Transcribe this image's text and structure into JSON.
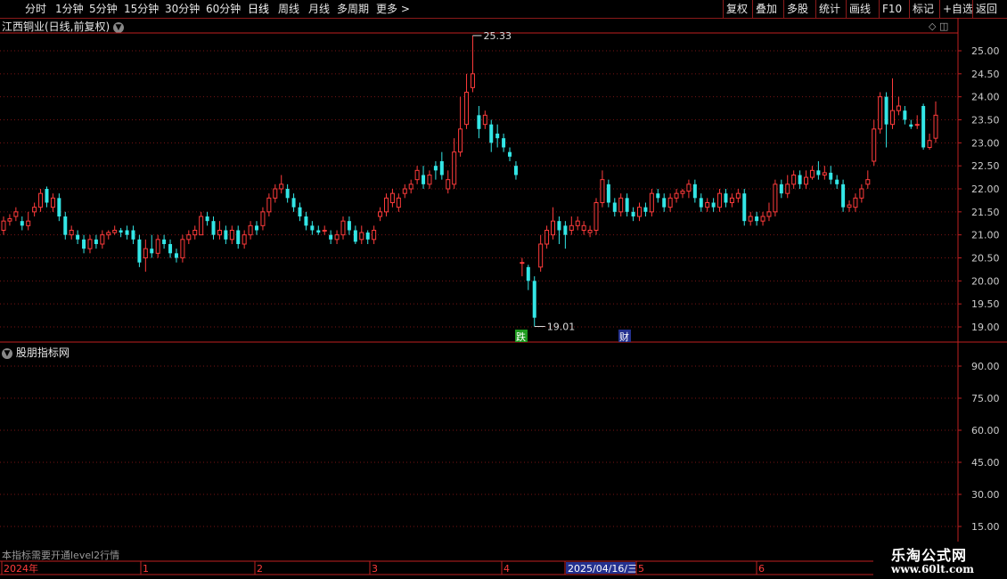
{
  "toolbar": {
    "periods": [
      "分时",
      "1分钟",
      "5分钟",
      "15分钟",
      "30分钟",
      "60分钟",
      "日线",
      "周线",
      "月线",
      "多周期",
      "更多 >"
    ],
    "active_period": "日线",
    "actions": [
      "复权",
      "叠加",
      "多股",
      "统计",
      "画线",
      "F10",
      "标记",
      "+自选",
      "返回"
    ]
  },
  "main_panel": {
    "title": "江西铜业(日线,前复权)"
  },
  "sub_panel": {
    "title": "股朋指标网",
    "note": "本指标需要开通level2行情"
  },
  "brand": {
    "name": "乐淘公式网",
    "url": "www.60lt.com"
  },
  "colors": {
    "up": "#ff3b3b",
    "down": "#33e6e6",
    "grid": "#7a1414",
    "axis": "#c02020",
    "text": "#cccccc",
    "badge_green": "#1e9a1e",
    "badge_blue": "#24318f"
  },
  "chart_data": [
    {
      "type": "candlestick",
      "title": "江西铜业(日线,前复权)",
      "ylim": [
        18.8,
        25.6
      ],
      "y_ticks": [
        "25.00",
        "24.50",
        "24.00",
        "23.50",
        "23.00",
        "22.50",
        "22.00",
        "21.50",
        "21.00",
        "20.50",
        "20.00",
        "19.50",
        "19.00"
      ],
      "annotations": {
        "high_label": "25.33",
        "low_label": "19.01"
      },
      "badges": [
        {
          "text": "跌",
          "color": "green"
        },
        {
          "text": "财",
          "color": "blue"
        }
      ],
      "x_labels": [
        "2024年",
        "1",
        "2",
        "3",
        "4",
        "2025/04/16/三",
        "5",
        "6"
      ],
      "candles": [
        [
          21.1,
          21.3,
          21.4,
          21.0
        ],
        [
          21.3,
          21.35,
          21.45,
          21.2
        ],
        [
          21.4,
          21.5,
          21.6,
          21.3
        ],
        [
          21.3,
          21.2,
          21.4,
          21.1
        ],
        [
          21.2,
          21.3,
          21.5,
          21.1
        ],
        [
          21.5,
          21.6,
          21.7,
          21.4
        ],
        [
          21.6,
          21.9,
          22.0,
          21.5
        ],
        [
          22.0,
          21.7,
          22.05,
          21.6
        ],
        [
          21.6,
          21.8,
          21.9,
          21.5
        ],
        [
          21.8,
          21.4,
          21.9,
          21.3
        ],
        [
          21.4,
          21.0,
          21.5,
          20.9
        ],
        [
          21.0,
          21.1,
          21.2,
          20.9
        ],
        [
          21.0,
          20.9,
          21.1,
          20.8
        ],
        [
          20.9,
          20.7,
          21.0,
          20.6
        ],
        [
          20.7,
          20.9,
          21.0,
          20.6
        ],
        [
          20.9,
          20.8,
          21.0,
          20.7
        ],
        [
          20.8,
          21.0,
          21.1,
          20.7
        ],
        [
          21.0,
          21.05,
          21.1,
          20.9
        ],
        [
          21.05,
          21.1,
          21.2,
          21.0
        ],
        [
          21.1,
          21.05,
          21.15,
          20.95
        ],
        [
          21.1,
          21.0,
          21.2,
          20.9
        ],
        [
          21.1,
          20.9,
          21.2,
          20.8
        ],
        [
          20.9,
          20.4,
          21.0,
          20.3
        ],
        [
          20.5,
          20.7,
          20.9,
          20.2
        ],
        [
          20.7,
          20.6,
          21.0,
          20.5
        ],
        [
          20.6,
          20.9,
          21.0,
          20.5
        ],
        [
          20.9,
          20.8,
          21.0,
          20.7
        ],
        [
          20.8,
          20.6,
          20.9,
          20.5
        ],
        [
          20.6,
          20.5,
          20.7,
          20.4
        ],
        [
          20.5,
          20.9,
          21.0,
          20.4
        ],
        [
          20.9,
          21.0,
          21.1,
          20.8
        ],
        [
          21.0,
          21.1,
          21.2,
          20.9
        ],
        [
          21.0,
          21.4,
          21.5,
          21.0
        ],
        [
          21.4,
          21.3,
          21.5,
          21.2
        ],
        [
          21.3,
          21.0,
          21.4,
          20.9
        ],
        [
          21.0,
          21.1,
          21.3,
          20.9
        ],
        [
          21.1,
          20.9,
          21.2,
          20.8
        ],
        [
          20.9,
          21.1,
          21.2,
          20.8
        ],
        [
          21.1,
          20.8,
          21.2,
          20.7
        ],
        [
          20.8,
          21.0,
          21.1,
          20.7
        ],
        [
          21.0,
          21.2,
          21.3,
          20.9
        ],
        [
          21.2,
          21.1,
          21.3,
          21.0
        ],
        [
          21.2,
          21.5,
          21.6,
          21.1
        ],
        [
          21.5,
          21.8,
          21.9,
          21.4
        ],
        [
          21.8,
          22.0,
          22.1,
          21.7
        ],
        [
          22.0,
          22.1,
          22.3,
          21.9
        ],
        [
          22.0,
          21.8,
          22.1,
          21.7
        ],
        [
          21.8,
          21.6,
          21.9,
          21.5
        ],
        [
          21.6,
          21.4,
          21.7,
          21.3
        ],
        [
          21.4,
          21.2,
          21.5,
          21.1
        ],
        [
          21.2,
          21.1,
          21.3,
          21.0
        ],
        [
          21.1,
          21.05,
          21.2,
          21.0
        ],
        [
          21.1,
          21.1,
          21.2,
          21.0
        ],
        [
          21.0,
          20.9,
          21.1,
          20.8
        ],
        [
          20.9,
          21.0,
          21.1,
          20.8
        ],
        [
          21.0,
          21.3,
          21.4,
          20.9
        ],
        [
          21.3,
          21.1,
          21.4,
          21.0
        ],
        [
          21.1,
          20.85,
          21.2,
          20.8
        ],
        [
          20.9,
          21.05,
          21.2,
          20.8
        ],
        [
          21.05,
          20.9,
          21.1,
          20.8
        ],
        [
          20.9,
          21.1,
          21.2,
          20.8
        ],
        [
          21.4,
          21.5,
          21.6,
          21.3
        ],
        [
          21.5,
          21.8,
          21.9,
          21.4
        ],
        [
          21.7,
          21.9,
          22.0,
          21.6
        ],
        [
          21.6,
          21.8,
          21.9,
          21.5
        ],
        [
          21.9,
          22.0,
          22.1,
          21.8
        ],
        [
          22.0,
          22.1,
          22.2,
          21.9
        ],
        [
          22.2,
          22.4,
          22.5,
          22.1
        ],
        [
          22.3,
          22.1,
          22.5,
          22.0
        ],
        [
          22.1,
          22.3,
          22.4,
          22.0
        ],
        [
          22.5,
          22.4,
          22.6,
          22.2
        ],
        [
          22.6,
          22.3,
          22.8,
          22.2
        ],
        [
          22.0,
          22.2,
          22.4,
          21.9
        ],
        [
          22.1,
          22.8,
          23.1,
          22.0
        ],
        [
          22.8,
          23.3,
          24.0,
          22.7
        ],
        [
          23.4,
          24.1,
          24.5,
          23.3
        ],
        [
          24.2,
          24.5,
          25.33,
          24.1
        ],
        [
          23.6,
          23.3,
          23.8,
          23.1
        ],
        [
          23.4,
          23.6,
          23.7,
          23.3
        ],
        [
          23.4,
          23.0,
          23.5,
          22.8
        ],
        [
          23.2,
          23.1,
          23.4,
          22.9
        ],
        [
          23.1,
          22.9,
          23.2,
          22.8
        ],
        [
          22.8,
          22.7,
          22.9,
          22.6
        ],
        [
          22.5,
          22.3,
          22.6,
          22.2
        ],
        [
          20.4,
          20.4,
          20.5,
          20.1
        ],
        [
          20.3,
          20.0,
          20.35,
          19.8
        ],
        [
          20.0,
          19.2,
          20.1,
          19.01
        ],
        [
          20.3,
          20.8,
          21.0,
          20.2
        ],
        [
          20.8,
          21.1,
          21.2,
          20.7
        ],
        [
          21.0,
          21.3,
          21.6,
          20.9
        ],
        [
          21.3,
          21.1,
          21.4,
          20.8
        ],
        [
          21.2,
          21.0,
          21.3,
          20.7
        ],
        [
          21.1,
          21.2,
          21.4,
          21.0
        ],
        [
          21.2,
          21.3,
          21.4,
          21.1
        ],
        [
          21.1,
          21.2,
          21.3,
          21.0
        ],
        [
          21.05,
          21.1,
          21.2,
          20.95
        ],
        [
          21.1,
          21.7,
          21.8,
          21.0
        ],
        [
          21.7,
          22.2,
          22.4,
          21.6
        ],
        [
          22.1,
          21.7,
          22.2,
          21.6
        ],
        [
          21.7,
          21.5,
          21.8,
          21.4
        ],
        [
          21.5,
          21.8,
          21.9,
          21.4
        ],
        [
          21.8,
          21.5,
          21.9,
          21.4
        ],
        [
          21.5,
          21.4,
          21.6,
          21.3
        ],
        [
          21.4,
          21.6,
          21.7,
          21.3
        ],
        [
          21.6,
          21.5,
          21.7,
          21.4
        ],
        [
          21.5,
          21.9,
          22.0,
          21.4
        ],
        [
          21.9,
          21.8,
          22.0,
          21.7
        ],
        [
          21.8,
          21.6,
          21.9,
          21.5
        ],
        [
          21.6,
          21.8,
          21.9,
          21.5
        ],
        [
          21.8,
          21.9,
          22.0,
          21.7
        ],
        [
          21.9,
          21.95,
          22.0,
          21.8
        ],
        [
          21.95,
          22.1,
          22.2,
          21.8
        ],
        [
          22.1,
          21.8,
          22.2,
          21.7
        ],
        [
          21.8,
          21.6,
          21.9,
          21.5
        ],
        [
          21.6,
          21.7,
          21.8,
          21.5
        ],
        [
          21.7,
          21.6,
          21.8,
          21.5
        ],
        [
          21.6,
          21.9,
          22.0,
          21.5
        ],
        [
          21.9,
          21.7,
          22.0,
          21.6
        ],
        [
          21.7,
          21.8,
          21.9,
          21.6
        ],
        [
          21.8,
          21.9,
          22.0,
          21.7
        ],
        [
          21.9,
          21.3,
          22.0,
          21.2
        ],
        [
          21.3,
          21.4,
          21.5,
          21.2
        ],
        [
          21.4,
          21.3,
          21.5,
          21.2
        ],
        [
          21.3,
          21.4,
          21.5,
          21.2
        ],
        [
          21.4,
          21.5,
          21.7,
          21.3
        ],
        [
          21.5,
          22.1,
          22.2,
          21.4
        ],
        [
          22.1,
          21.9,
          22.2,
          21.8
        ],
        [
          21.9,
          22.1,
          22.3,
          21.8
        ],
        [
          22.1,
          22.3,
          22.4,
          22.0
        ],
        [
          22.3,
          22.1,
          22.4,
          22.0
        ],
        [
          22.1,
          22.25,
          22.4,
          22.0
        ],
        [
          22.25,
          22.4,
          22.5,
          22.2
        ],
        [
          22.4,
          22.3,
          22.6,
          22.2
        ],
        [
          22.3,
          22.35,
          22.5,
          22.2
        ],
        [
          22.35,
          22.2,
          22.5,
          22.1
        ],
        [
          22.2,
          22.1,
          22.3,
          22.0
        ],
        [
          22.1,
          21.6,
          22.2,
          21.5
        ],
        [
          21.6,
          21.65,
          21.75,
          21.5
        ],
        [
          21.6,
          21.8,
          21.9,
          21.5
        ],
        [
          21.8,
          22.0,
          22.1,
          21.7
        ],
        [
          22.1,
          22.2,
          22.4,
          22.0
        ],
        [
          22.6,
          23.3,
          23.5,
          22.5
        ],
        [
          23.3,
          24.0,
          24.1,
          23.2
        ],
        [
          24.0,
          23.4,
          24.1,
          22.9
        ],
        [
          23.4,
          23.7,
          24.4,
          23.3
        ],
        [
          23.7,
          23.8,
          24.0,
          23.6
        ],
        [
          23.7,
          23.5,
          23.8,
          23.4
        ],
        [
          23.4,
          23.35,
          23.5,
          23.3
        ],
        [
          23.4,
          23.4,
          23.6,
          23.3
        ],
        [
          23.8,
          22.9,
          23.85,
          22.85
        ],
        [
          22.9,
          23.05,
          23.2,
          22.85
        ],
        [
          23.1,
          23.6,
          23.9,
          23.0
        ]
      ]
    },
    {
      "type": "line",
      "title": "股朋指标网",
      "ylim": [
        12,
        100
      ],
      "y_ticks": [
        "90.00",
        "75.00",
        "60.00",
        "45.00",
        "30.00",
        "15.00"
      ],
      "series": []
    }
  ]
}
